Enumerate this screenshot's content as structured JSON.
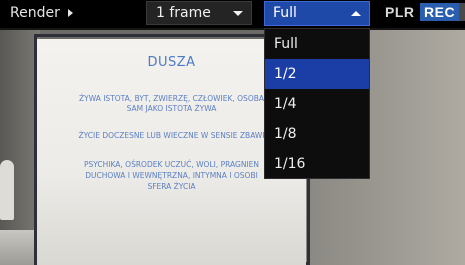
{
  "toolbar": {
    "render_label": "Render",
    "frame_select_value": "1 frame",
    "resolution_select_value": "Full",
    "brand_plr": "PLR",
    "brand_rec": "REC"
  },
  "resolution_dropdown": {
    "options": [
      "Full",
      "1/2",
      "1/4",
      "1/8",
      "1/16"
    ],
    "highlighted": "1/2"
  },
  "slide": {
    "title": "DUSZA",
    "lines": [
      "ŻYWA ISTOTA, BYT, ZWIERZĘ, CZŁOWIEK, OSOBA",
      "SAM JAKO ISTOTA ŻYWA",
      "ŻYCIE DOCZESNE LUB WIECZNE W SENSIE ZBAWI",
      "PSYCHIKA, OŚRODEK UCZUĆ, WOLI, PRAGNIEN",
      "DUCHOWA I WEWNĘTRZNA, INTYMNA I OSOBI",
      "SFERA ŻYCIA"
    ]
  },
  "colors": {
    "accent_blue": "#1b3ea6",
    "slide_text": "#5b7fc4"
  }
}
